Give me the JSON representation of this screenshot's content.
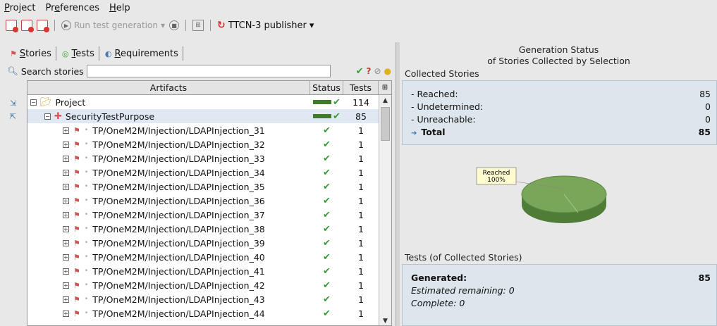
{
  "menu": [
    {
      "key": "P",
      "rest": "roject"
    },
    {
      "pre": "Pr",
      "key": "e",
      "rest": "ferences"
    },
    {
      "key": "H",
      "rest": "elp"
    }
  ],
  "toolbar": {
    "run_label": "Run test generation",
    "publisher_label": "TTCN-3 publisher"
  },
  "tabs": [
    {
      "key": "S",
      "rest": "tories",
      "icon": "story-icon"
    },
    {
      "key": "T",
      "rest": "ests",
      "icon": "tests-icon"
    },
    {
      "key": "R",
      "rest": "equirements",
      "icon": "requirements-icon"
    }
  ],
  "search": {
    "label": "Search stories",
    "value": ""
  },
  "table": {
    "headers": {
      "artifacts": "Artifacts",
      "status": "Status",
      "tests": "Tests"
    },
    "project": {
      "name": "Project",
      "tests": "114"
    },
    "purpose": {
      "name": "SecurityTestPurpose",
      "tests": "85"
    },
    "stories": [
      {
        "name": "TP/OneM2M/Injection/LDAPInjection_31",
        "tests": "1"
      },
      {
        "name": "TP/OneM2M/Injection/LDAPInjection_32",
        "tests": "1"
      },
      {
        "name": "TP/OneM2M/Injection/LDAPInjection_33",
        "tests": "1"
      },
      {
        "name": "TP/OneM2M/Injection/LDAPInjection_34",
        "tests": "1"
      },
      {
        "name": "TP/OneM2M/Injection/LDAPInjection_35",
        "tests": "1"
      },
      {
        "name": "TP/OneM2M/Injection/LDAPInjection_36",
        "tests": "1"
      },
      {
        "name": "TP/OneM2M/Injection/LDAPInjection_37",
        "tests": "1"
      },
      {
        "name": "TP/OneM2M/Injection/LDAPInjection_38",
        "tests": "1"
      },
      {
        "name": "TP/OneM2M/Injection/LDAPInjection_39",
        "tests": "1"
      },
      {
        "name": "TP/OneM2M/Injection/LDAPInjection_40",
        "tests": "1"
      },
      {
        "name": "TP/OneM2M/Injection/LDAPInjection_41",
        "tests": "1"
      },
      {
        "name": "TP/OneM2M/Injection/LDAPInjection_42",
        "tests": "1"
      },
      {
        "name": "TP/OneM2M/Injection/LDAPInjection_43",
        "tests": "1"
      },
      {
        "name": "TP/OneM2M/Injection/LDAPInjection_44",
        "tests": "1"
      }
    ]
  },
  "generation": {
    "title_line1": "Generation Status",
    "title_line2": "of Stories Collected by Selection",
    "collected_label": "Collected Stories",
    "stats": [
      {
        "label": "- Reached:",
        "value": "85"
      },
      {
        "label": "- Undetermined:",
        "value": "0"
      },
      {
        "label": "- Unreachable:",
        "value": "0"
      }
    ],
    "total_label": "Total",
    "total_value": "85",
    "chart_label_line1": "Reached",
    "chart_label_line2": "100%",
    "chart_color": "#7aa65a"
  },
  "tests": {
    "section_label": "Tests (of Collected Stories)",
    "generated_label": "Generated:",
    "generated_value": "85",
    "remaining": "Estimated remaining: 0",
    "complete": "Complete: 0"
  }
}
